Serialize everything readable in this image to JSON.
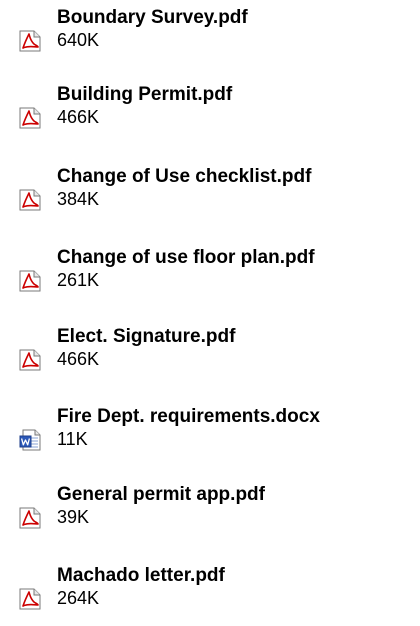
{
  "files": [
    {
      "name": "Boundary Survey.pdf",
      "size": "640K",
      "icon": "pdf-icon"
    },
    {
      "name": "Building Permit.pdf",
      "size": "466K",
      "icon": "pdf-icon"
    },
    {
      "name": "Change of Use checklist.pdf",
      "size": "384K",
      "icon": "pdf-icon"
    },
    {
      "name": "Change of use floor plan.pdf",
      "size": "261K",
      "icon": "pdf-icon"
    },
    {
      "name": "Elect. Signature.pdf",
      "size": "466K",
      "icon": "pdf-icon"
    },
    {
      "name": "Fire Dept. requirements.docx",
      "size": "11K",
      "icon": "word-icon"
    },
    {
      "name": "General permit app.pdf",
      "size": "39K",
      "icon": "pdf-icon"
    },
    {
      "name": "Machado letter.pdf",
      "size": "264K",
      "icon": "pdf-icon"
    }
  ],
  "colors": {
    "pdf_accent": "#cc0000",
    "word_accent": "#2b58b8"
  }
}
